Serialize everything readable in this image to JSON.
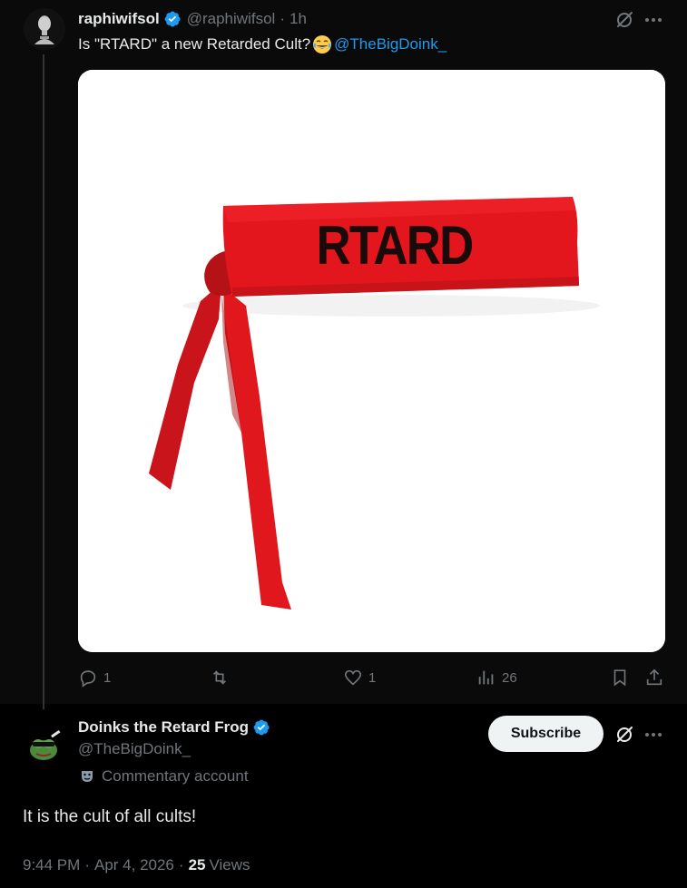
{
  "parent_tweet": {
    "author_name": "raphiwifsol",
    "author_handle": "@raphiwifsol",
    "separator": "·",
    "time": "1h",
    "text_before": "Is \"RTARD\" a new Retarded Cult?",
    "emoji": "😂",
    "mention": "@TheBigDoink_",
    "media": {
      "headband_text": "RTARD",
      "headband_color": "#e3161d",
      "background_color": "#ffffff"
    },
    "actions": {
      "replies": "1",
      "reposts": "",
      "likes": "1",
      "views": "26"
    }
  },
  "main_tweet": {
    "author_name": "Doinks the Retard Frog",
    "author_handle": "@TheBigDoink_",
    "label": "Commentary account",
    "subscribe_label": "Subscribe",
    "text": "It is the cult of all cults!",
    "time": "9:44 PM",
    "separator": "·",
    "date": "Apr 4, 2026",
    "views_count": "25",
    "views_label": "Views"
  },
  "icons": {
    "verified": "verified-badge-icon",
    "grok": "grok-icon",
    "more": "more-icon",
    "reply": "reply-icon",
    "repost": "repost-icon",
    "like": "like-icon",
    "views": "views-icon",
    "bookmark": "bookmark-icon",
    "share": "share-icon",
    "commentary": "theater-mask-icon"
  },
  "colors": {
    "accent": "#1d9bf0",
    "secondary_text": "#71767b",
    "primary_text": "#e7e9ea",
    "background": "#000000"
  }
}
